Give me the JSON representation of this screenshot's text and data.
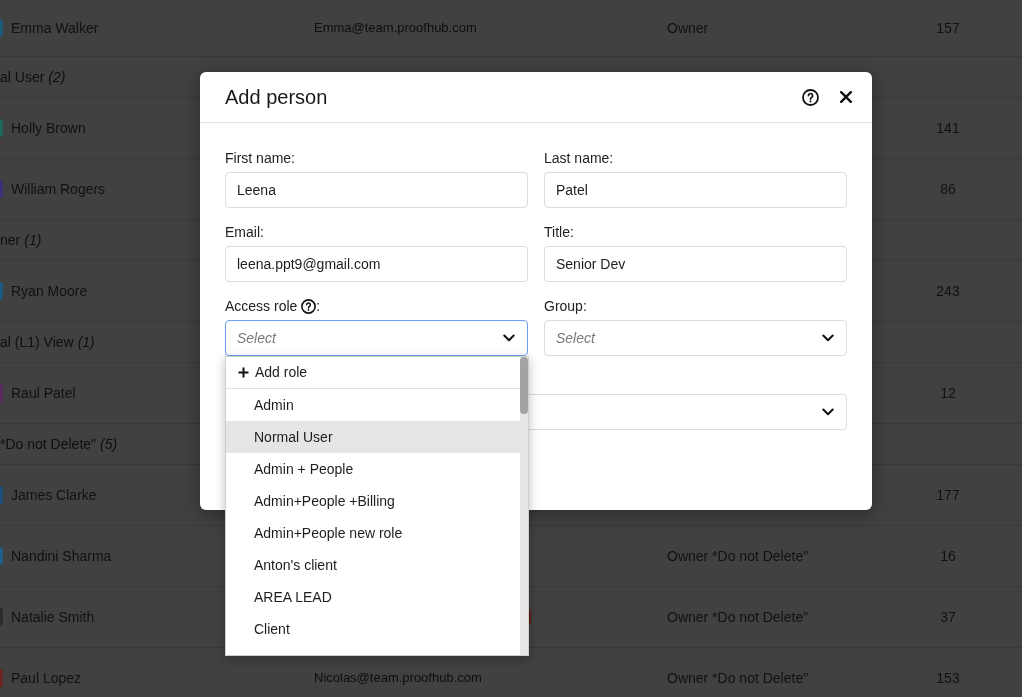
{
  "people_table": {
    "rows": [
      {
        "kind": "person",
        "name": "Emma Walker",
        "email": "Emma@team.proofhub.com",
        "role": "Owner",
        "count": "157",
        "color": "#1d5c78",
        "badge": false
      },
      {
        "kind": "group",
        "label": "al User",
        "count": "(2)"
      },
      {
        "kind": "person",
        "name": "Holly Brown",
        "count": "141",
        "color": "#1b6656",
        "badge": false
      },
      {
        "kind": "person",
        "name": "William Rogers",
        "count": "86",
        "color": "#3a3276",
        "badge": false
      },
      {
        "kind": "group",
        "label": "ner",
        "count": "(1)"
      },
      {
        "kind": "person",
        "name": "Ryan Moore",
        "count": "243",
        "color": "#1e5b82",
        "badge": false
      },
      {
        "kind": "group",
        "label": "al (L1) View",
        "count": "(1)"
      },
      {
        "kind": "person",
        "name": "Raul Patel",
        "count": "12",
        "color": "#5a2a5e",
        "badge": false
      },
      {
        "kind": "group",
        "label": "*Do not Delete\"",
        "count": "(5)"
      },
      {
        "kind": "person",
        "name": "James Clarke",
        "count": "177",
        "color": "#1f4f7a",
        "badge": false
      },
      {
        "kind": "person",
        "name": "Nandini Sharma",
        "role": "Owner *Do not Delete\"",
        "count": "16",
        "color": "#1f5f8a",
        "badge": false
      },
      {
        "kind": "person",
        "name": "Natalie Smith",
        "role": "Owner *Do not Delete\"",
        "count": "37",
        "color": "#2c2c2c",
        "badge": true
      },
      {
        "kind": "person",
        "name": "Paul Lopez",
        "email": "Nicolas@team.proofhub.com",
        "role": "Owner *Do not Delete\"",
        "count": "153",
        "color": "#6b2424",
        "badge": false
      }
    ]
  },
  "dialog": {
    "title": "Add person",
    "fields": [
      {
        "kind": "text",
        "label": "First name:",
        "help": false,
        "value": "Leena"
      },
      {
        "kind": "text",
        "label": "Last name:",
        "help": false,
        "value": "Patel"
      },
      {
        "kind": "text",
        "label": "Email:",
        "help": false,
        "value": "leena.ppt9@gmail.com"
      },
      {
        "kind": "text",
        "label": "Title:",
        "help": false,
        "value": "Senior Dev"
      },
      {
        "kind": "select",
        "label": "Access role",
        "help": true,
        "label_end": ":",
        "placeholder": "Select",
        "open": true
      },
      {
        "kind": "select",
        "label": "Group:",
        "help": false,
        "placeholder": "Select",
        "open": false
      },
      {
        "kind": "wide_select",
        "open": false
      }
    ]
  },
  "role_menu": {
    "add_label": "Add role",
    "items": [
      {
        "label": "Admin",
        "highlighted": false
      },
      {
        "label": "Normal User",
        "highlighted": true
      },
      {
        "label": "Admin + People",
        "highlighted": false
      },
      {
        "label": "Admin+People +Billing",
        "highlighted": false
      },
      {
        "label": "Admin+People new role",
        "highlighted": false
      },
      {
        "label": "Anton's client",
        "highlighted": false
      },
      {
        "label": "AREA LEAD",
        "highlighted": false
      },
      {
        "label": "Client",
        "highlighted": false
      }
    ]
  }
}
